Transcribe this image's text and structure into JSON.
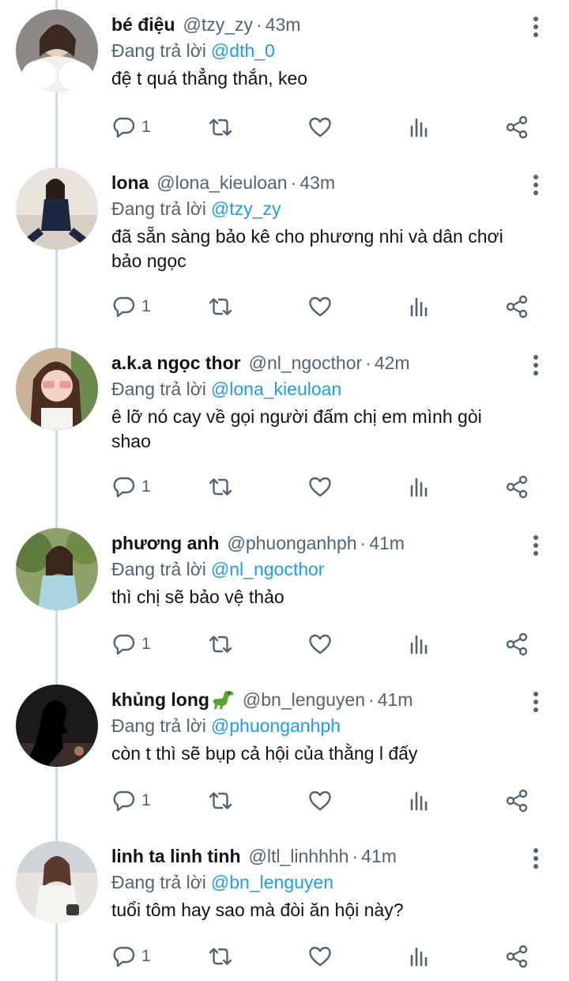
{
  "replying_label": "Đang trả lời",
  "colors": {
    "accent": "#1d9bf0",
    "muted": "#536471",
    "text": "#0f1419",
    "line": "#cfd9de"
  },
  "icons": [
    "more-vertical-icon",
    "reply-icon",
    "retweet-icon",
    "like-icon",
    "views-icon",
    "share-icon",
    "dinosaur-emoji-icon"
  ],
  "replies": [
    {
      "name": "bé điệu",
      "handle": "@tzy_zy",
      "sep": "·",
      "time": "43m",
      "replying_to": "@dth_0",
      "text": "đệ t quá thẳng thắn, keo",
      "reply_count": "1"
    },
    {
      "name": "lona",
      "handle": "@lona_kieuloan",
      "sep": "·",
      "time": "43m",
      "replying_to": "@tzy_zy",
      "text": "đã sẵn sàng bảo kê cho phương nhi và dân chơi\nbảo ngọc",
      "reply_count": "1"
    },
    {
      "name": "a.k.a ngọc thor",
      "handle": "@nl_ngocthor",
      "sep": "·",
      "time": "42m",
      "replying_to": "@lona_kieuloan",
      "text": "ê lỡ nó cay về gọi người đấm chị em mình gòi\nshao",
      "reply_count": "1"
    },
    {
      "name": "phương anh",
      "handle": "@phuonganhph",
      "sep": "·",
      "time": "41m",
      "replying_to": "@nl_ngocthor",
      "text": "thì chị sẽ bảo vệ thảo",
      "reply_count": "1"
    },
    {
      "name": "khủng long",
      "handle": "@bn_lenguyen",
      "sep": "·",
      "time": "41m",
      "replying_to": "@phuonganhph",
      "text": "còn t thì sẽ bụp cả hội của thằng l đấy",
      "reply_count": "1"
    },
    {
      "name": "linh ta linh tinh",
      "handle": "@ltl_linhhhh",
      "sep": "·",
      "time": "41m",
      "replying_to": "@bn_lenguyen",
      "text": "tuổi tôm hay sao mà đòi ăn hội này?",
      "reply_count": "1"
    }
  ]
}
